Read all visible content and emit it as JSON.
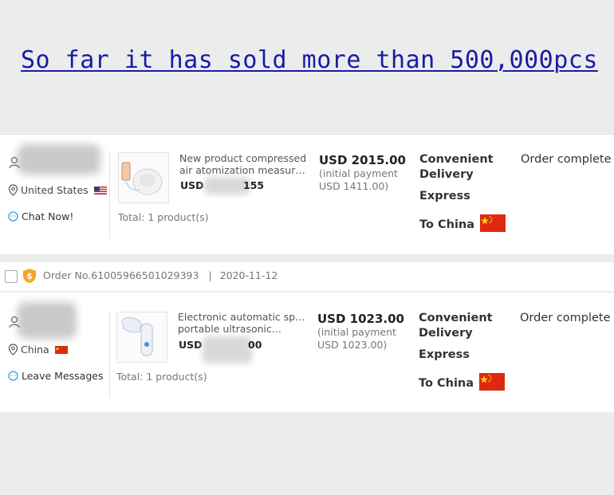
{
  "headline": "So far it has sold more than 500,000pcs",
  "orders": [
    {
      "country": "United States",
      "contact_label": "Chat Now!",
      "product_line1": "New product compressed",
      "product_line2": "air atomization measurin...",
      "usd_prefix": "USD",
      "usd_suffix": "155",
      "total": "Total:  1 product(s)",
      "price": "USD 2015.00",
      "price_note1": "(initial payment",
      "price_note2": "USD 1411.00)",
      "shipping_line1": "Convenient",
      "shipping_line2": "Delivery",
      "shipping_line3": "Express",
      "destination": "To China",
      "status": "Order complete"
    },
    {
      "country": "China",
      "contact_label": "Leave Messages",
      "product_line1": "Electronic automatic spray",
      "product_line2": "portable ultrasonic...",
      "usd_prefix": "USD",
      "usd_suffix": "00",
      "total": "Total:  1 product(s)",
      "price": "USD 1023.00",
      "price_note1": "(initial payment",
      "price_note2": "USD 1023.00)",
      "shipping_line1": "Convenient",
      "shipping_line2": "Delivery",
      "shipping_line3": "Express",
      "destination": "To China",
      "status": "Order complete"
    }
  ],
  "order_header": {
    "order_no": "Order No.61005966501029393",
    "separator": "|",
    "date": "2020-11-12"
  },
  "icons": {
    "user": "user-icon",
    "location": "location-pin-icon",
    "chat": "chat-bubble-icon",
    "badge": "shield-badge-icon",
    "flag_us": "us-flag-icon",
    "flag_cn": "china-flag-icon"
  },
  "colors": {
    "headline": "#1a1aa6",
    "badge": "#f5a623",
    "chat_icon": "#3aa0e0",
    "flag_red": "#de2910",
    "flag_star": "#ffde00"
  }
}
